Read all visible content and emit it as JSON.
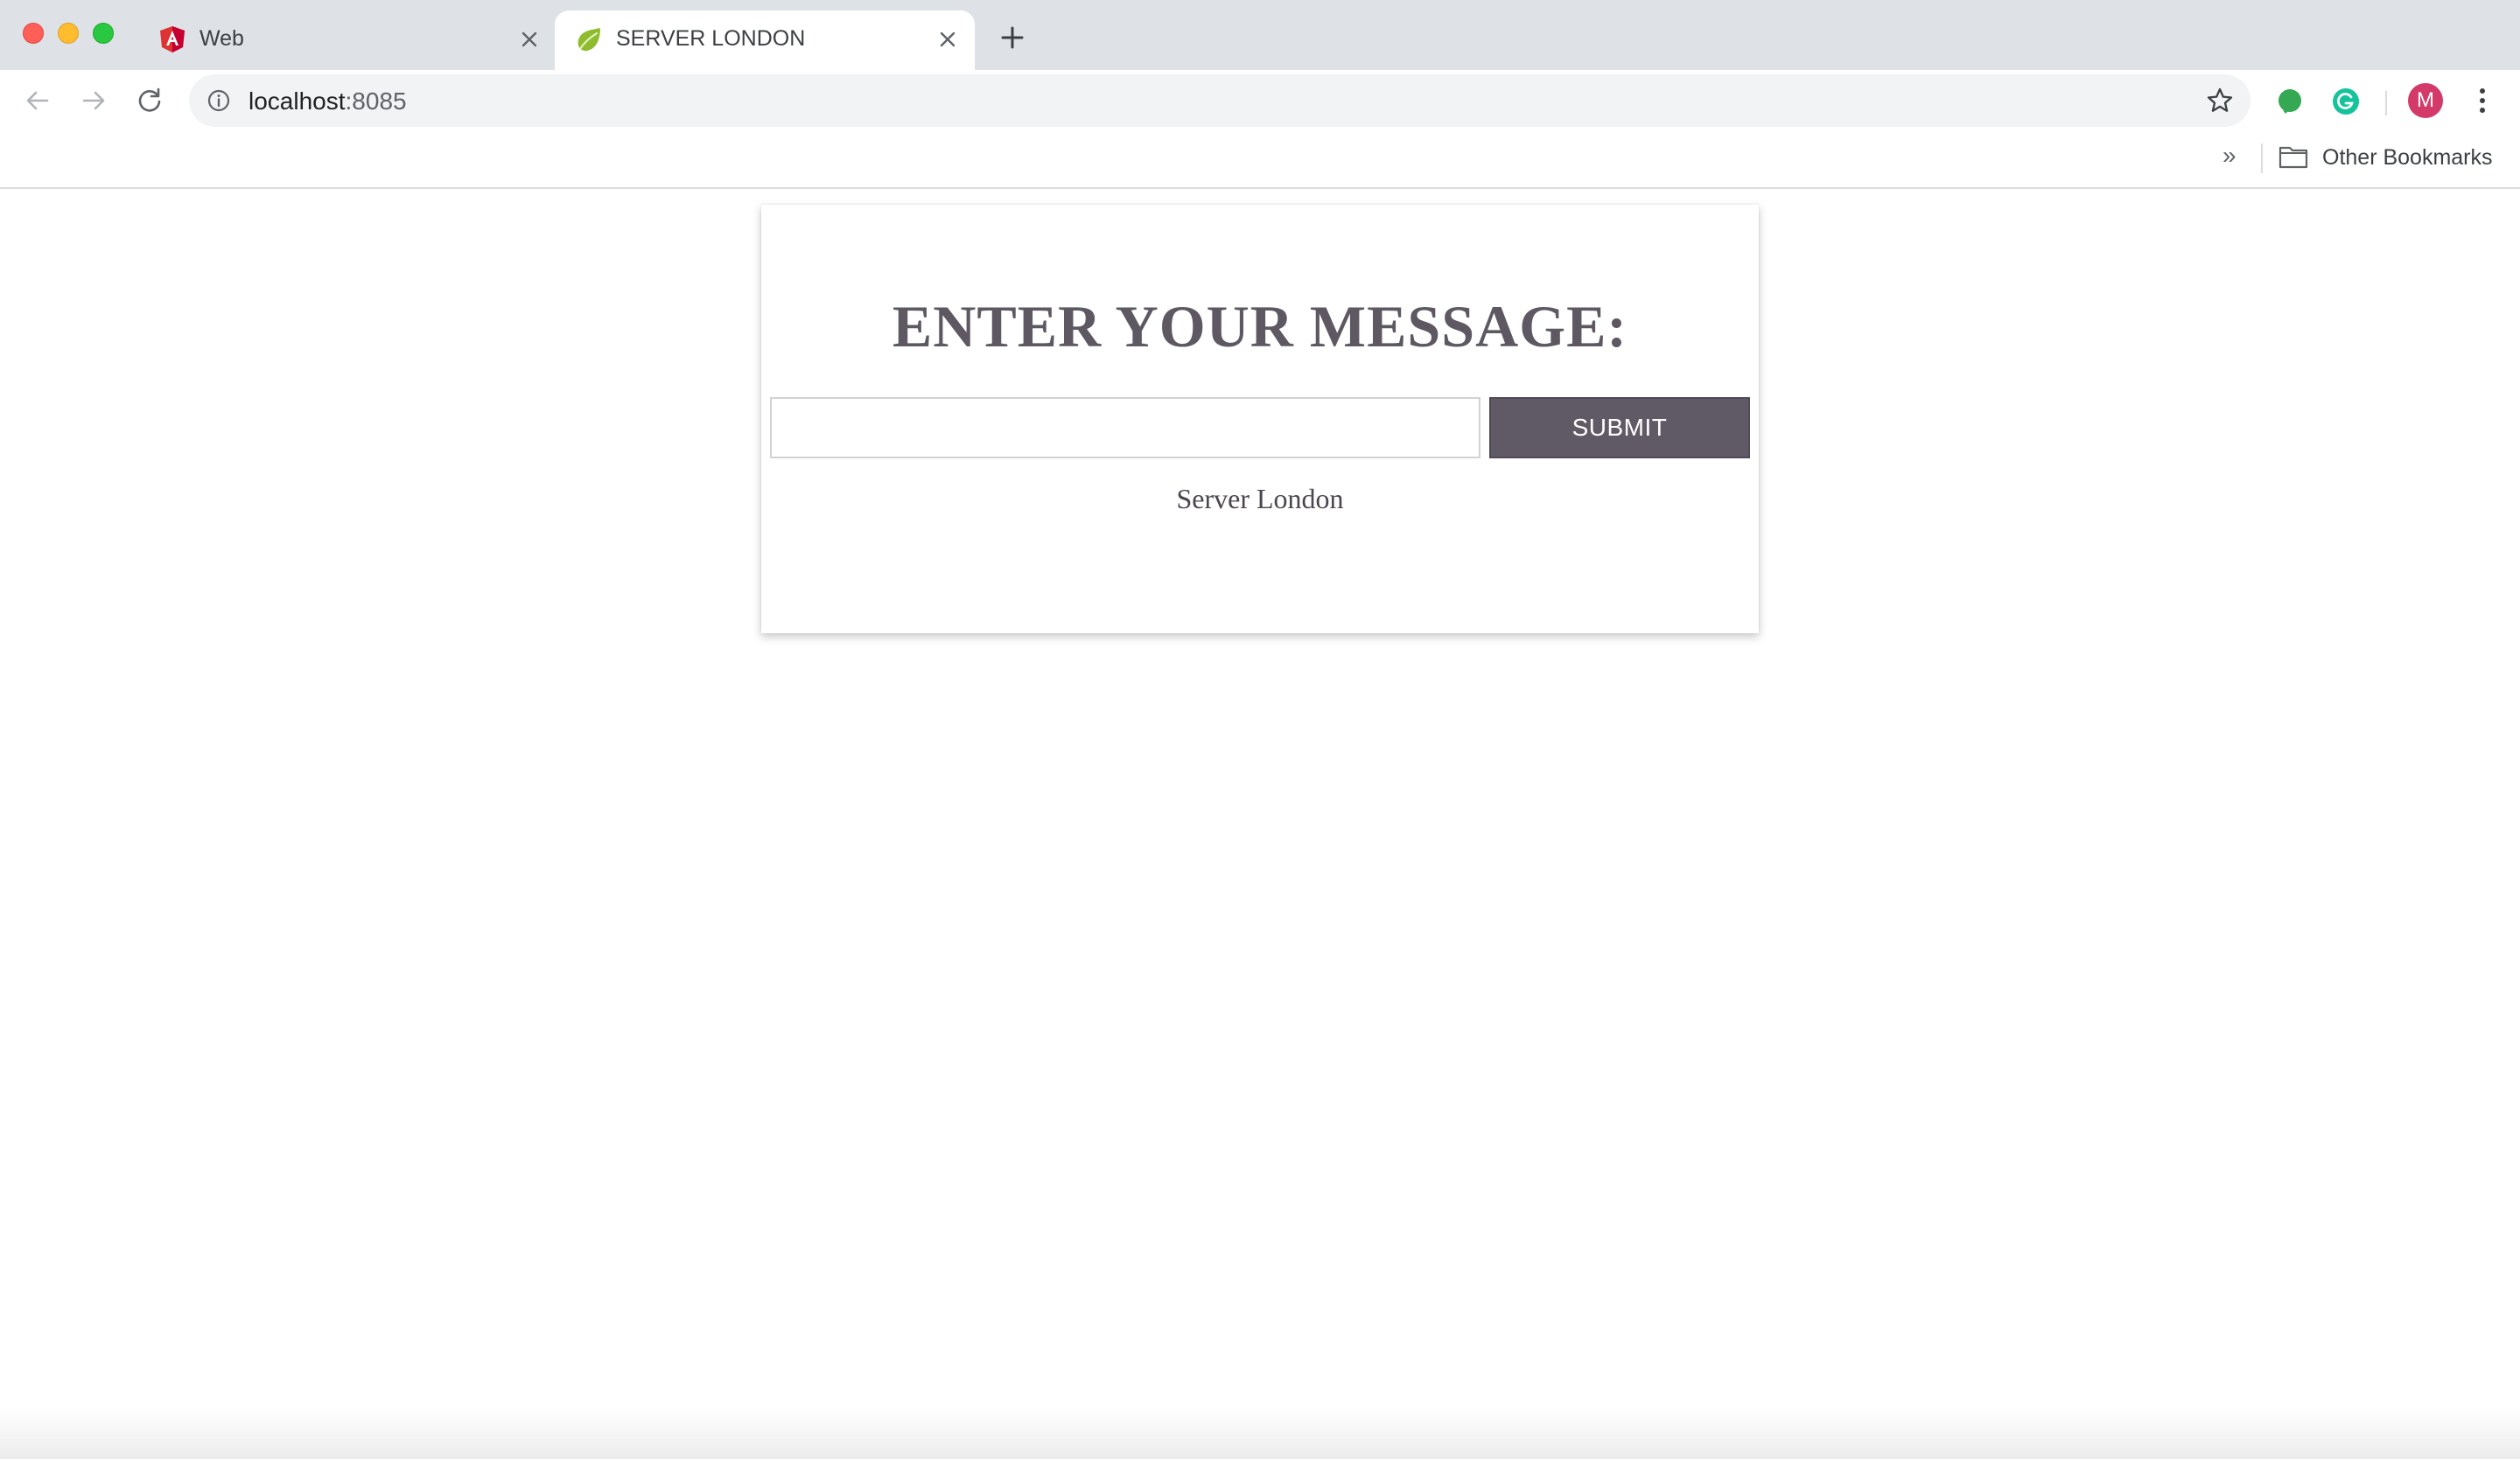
{
  "browser": {
    "tabs": [
      {
        "title": "Web",
        "favicon": "angular-icon",
        "active": false
      },
      {
        "title": "SERVER LONDON",
        "favicon": "spring-leaf-icon",
        "active": true
      }
    ],
    "url": {
      "host": "localhost",
      "port": ":8085"
    },
    "profile_initial": "M",
    "bookmarks": {
      "overflow": "»",
      "other_label": "Other Bookmarks"
    }
  },
  "page": {
    "heading": "ENTER YOUR MESSAGE:",
    "message_input": {
      "value": "",
      "placeholder": ""
    },
    "submit_label": "SUBMIT",
    "server_label": "Server London"
  },
  "colors": {
    "accent": "#605a66",
    "heading": "#5e5863",
    "avatar": "#d33a6a"
  }
}
